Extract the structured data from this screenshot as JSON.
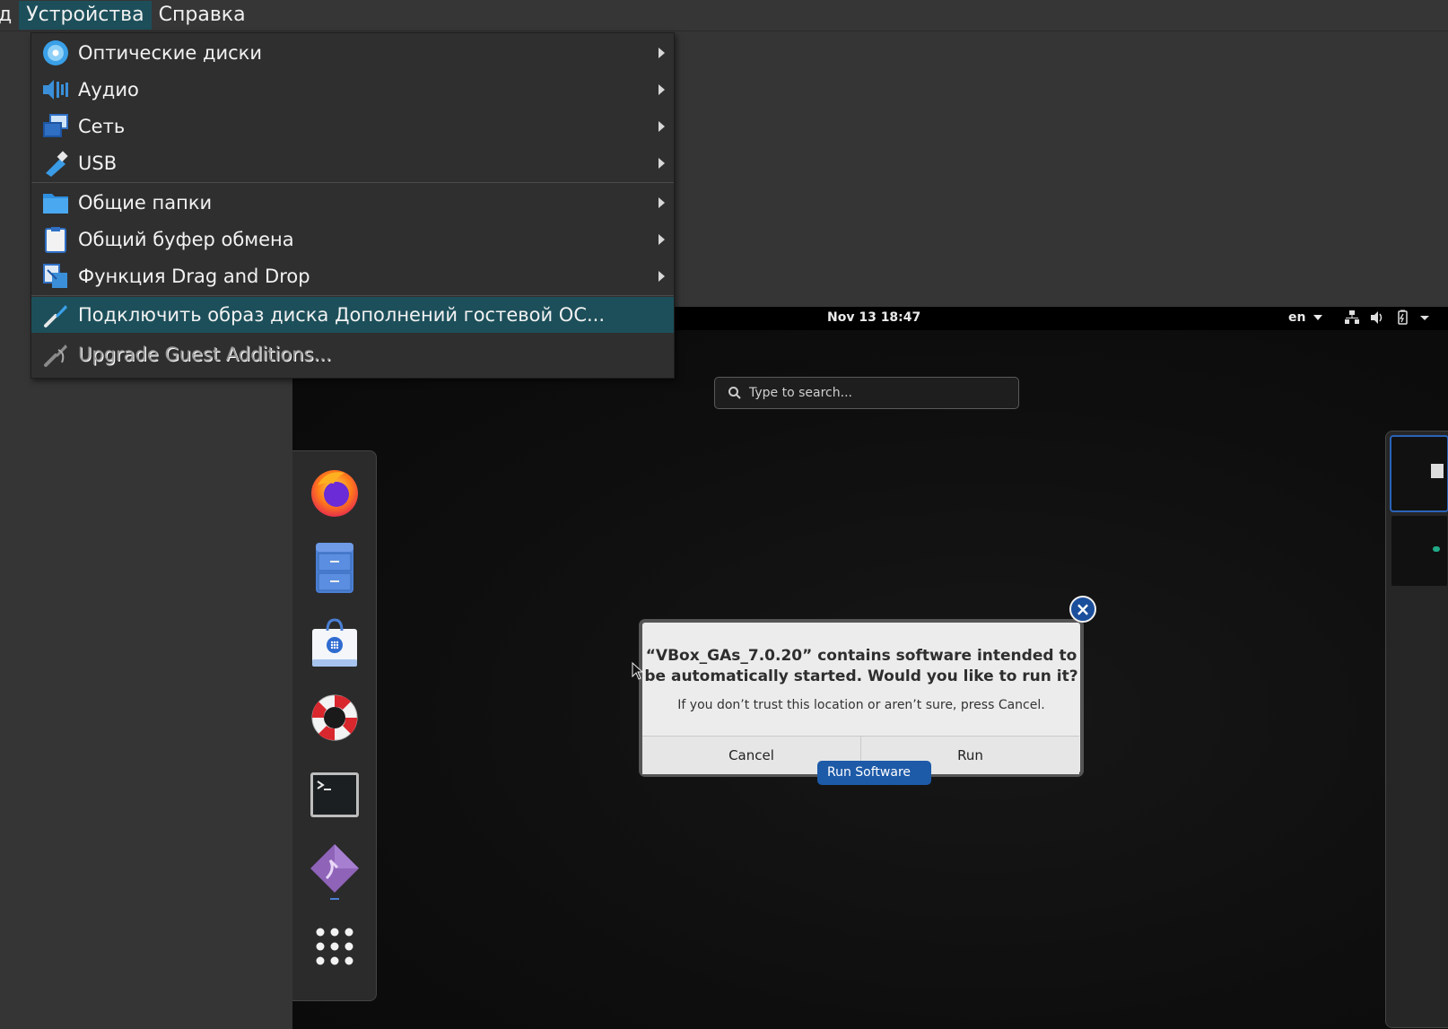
{
  "menubar": {
    "items": [
      {
        "label": "д"
      },
      {
        "label": "Устройства"
      },
      {
        "label": "Справка"
      }
    ]
  },
  "devices_menu": {
    "items": [
      {
        "label": "Оптические диски",
        "icon": "optical-disc-icon",
        "submenu": true
      },
      {
        "label": "Аудио",
        "icon": "audio-icon",
        "submenu": true
      },
      {
        "label": "Сеть",
        "icon": "network-icon",
        "submenu": true
      },
      {
        "label": "USB",
        "icon": "usb-icon",
        "submenu": true
      },
      {
        "label": "Общие папки",
        "icon": "shared-folder-icon",
        "submenu": true
      },
      {
        "label": "Общий буфер обмена",
        "icon": "clipboard-icon",
        "submenu": true
      },
      {
        "label": "Функция Drag and Drop",
        "icon": "drag-drop-icon",
        "submenu": true
      },
      {
        "label": "Подключить образ диска Дополнений гостевой ОС...",
        "icon": "guest-additions-icon",
        "highlighted": true
      },
      {
        "label": "Upgrade Guest Additions...",
        "icon": "upgrade-guest-additions-icon",
        "disabled": true
      }
    ]
  },
  "guest": {
    "topbar": {
      "clock": "Nov 13  18:47",
      "language": "en"
    },
    "search": {
      "placeholder": "Type to search..."
    },
    "dash_apps": [
      "firefox-icon",
      "file-cabinet-icon",
      "software-store-icon",
      "help-lifebuoy-icon",
      "terminal-icon",
      "virtualbox-additions-icon",
      "show-apps-icon"
    ],
    "dialog": {
      "title": "“VBox_GAs_7.0.20” contains software intended to be automatically started. Would you like to run it?",
      "title_line1": "“VBox_GAs_7.0.20” contains software intended to",
      "title_line2": "be automatically started. Would you like to run it?",
      "subtitle": "If you don’t trust this location or aren’t sure, press Cancel.",
      "cancel_label": "Cancel",
      "run_label": "Run"
    },
    "tooltip": "Run Software"
  },
  "colors": {
    "menu_highlight": "#1c4f5a",
    "accent_blue": "#1d5aa8"
  }
}
